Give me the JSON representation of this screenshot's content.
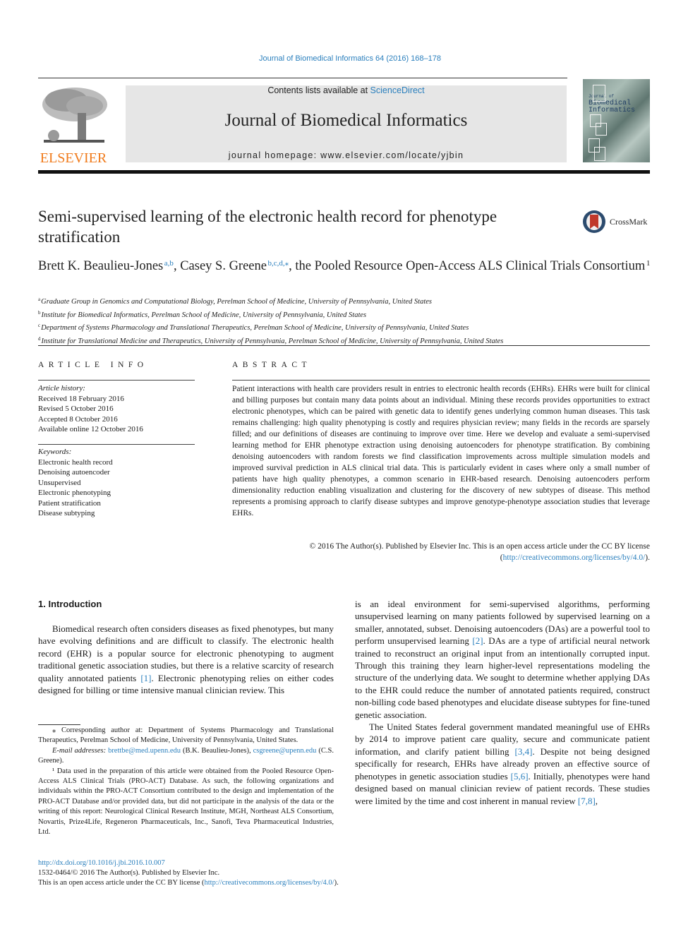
{
  "header": {
    "journal_ref": "Journal of Biomedical Informatics 64 (2016) 168–178",
    "contents_prefix": "Contents lists available at ",
    "contents_link": "ScienceDirect",
    "journal_title": "Journal of Biomedical Informatics",
    "homepage": "journal homepage: www.elsevier.com/locate/yjbin",
    "publisher_logo_text": "ELSEVIER",
    "cover_text": [
      "Journal of",
      "Biomedical",
      "Informatics"
    ],
    "crossmark_label": "CrossMark"
  },
  "colors": {
    "link": "#2a7fbd",
    "elsevier_orange": "#f07b1c",
    "banner_gray": "#e6e6e6"
  },
  "article": {
    "title": "Semi-supervised learning of the electronic health record for phenotype stratification",
    "authors": [
      {
        "name": "Brett K. Beaulieu-Jones",
        "sup": "a,b",
        "sep": ", "
      },
      {
        "name": "Casey S. Greene",
        "sup": "b,c,d,⁎",
        "sep": ", "
      },
      {
        "name": "the Pooled Resource Open-Access ALS Clinical Trials Consortium",
        "sup": "1",
        "sep": ""
      }
    ],
    "affiliations": [
      {
        "key": "a",
        "text": "Graduate Group in Genomics and Computational Biology, Perelman School of Medicine, University of Pennsylvania, United States"
      },
      {
        "key": "b",
        "text": "Institute for Biomedical Informatics, Perelman School of Medicine, University of Pennsylvania, United States"
      },
      {
        "key": "c",
        "text": "Department of Systems Pharmacology and Translational Therapeutics, Perelman School of Medicine, University of Pennsylvania, United States"
      },
      {
        "key": "d",
        "text": "Institute for Translational Medicine and Therapeutics, University of Pennsylvania, Perelman School of Medicine, University of Pennsylvania, United States"
      }
    ]
  },
  "article_info": {
    "heading": "ARTICLE INFO",
    "history_label": "Article history:",
    "history": [
      "Received 18 February 2016",
      "Revised 5 October 2016",
      "Accepted 8 October 2016",
      "Available online 12 October 2016"
    ],
    "keywords_label": "Keywords:",
    "keywords": [
      "Electronic health record",
      "Denoising autoencoder",
      "Unsupervised",
      "Electronic phenotyping",
      "Patient stratification",
      "Disease subtyping"
    ]
  },
  "abstract": {
    "heading": "ABSTRACT",
    "text": "Patient interactions with health care providers result in entries to electronic health records (EHRs). EHRs were built for clinical and billing purposes but contain many data points about an individual. Mining these records provides opportunities to extract electronic phenotypes, which can be paired with genetic data to identify genes underlying common human diseases. This task remains challenging: high quality phenotyping is costly and requires physician review; many fields in the records are sparsely filled; and our definitions of diseases are continuing to improve over time. Here we develop and evaluate a semi-supervised learning method for EHR phenotype extraction using denoising autoencoders for phenotype stratification. By combining denoising autoencoders with random forests we find classification improvements across multiple simulation models and improved survival prediction in ALS clinical trial data. This is particularly evident in cases where only a small number of patients have high quality phenotypes, a common scenario in EHR-based research. Denoising autoencoders perform dimensionality reduction enabling visualization and clustering for the discovery of new subtypes of disease. This method represents a promising approach to clarify disease subtypes and improve genotype-phenotype association studies that leverage EHRs.",
    "license_text": "© 2016 The Author(s). Published by Elsevier Inc. This is an open access article under the CC BY license",
    "license_link": "http://creativecommons.org/licenses/by/4.0/"
  },
  "intro": {
    "heading": "1. Introduction",
    "p1_a": "Biomedical research often considers diseases as fixed phenotypes, but many have evolving definitions and are difficult to classify. The electronic health record (EHR) is a popular source for electronic phenotyping to augment traditional genetic association studies, but there is a relative scarcity of research quality annotated patients ",
    "p1_ref": "[1]",
    "p1_b": ". Electronic phenotyping relies on either codes designed for billing or time intensive manual clinician review. This",
    "col2_p1_a": "is an ideal environment for semi-supervised algorithms, performing unsupervised learning on many patients followed by supervised learning on a smaller, annotated, subset. Denoising autoencoders (DAs) are a powerful tool to perform unsupervised learning ",
    "col2_p1_ref": "[2]",
    "col2_p1_b": ". DAs are a type of artificial neural network trained to reconstruct an original input from an intentionally corrupted input. Through this training they learn higher-level representations modeling the structure of the underlying data. We sought to determine whether applying DAs to the EHR could reduce the number of annotated patients required, construct non-billing code based phenotypes and elucidate disease subtypes for fine-tuned genetic association.",
    "col2_p2_a": "The United States federal government mandated meaningful use of EHRs by 2014 to improve patient care quality, secure and communicate patient information, and clarify patient billing ",
    "col2_p2_ref1": "[3,4]",
    "col2_p2_b": ". Despite not being designed specifically for research, EHRs have already proven an effective source of phenotypes in genetic association studies ",
    "col2_p2_ref2": "[5,6]",
    "col2_p2_c": ". Initially, phenotypes were hand designed based on manual clinician review of patient records. These studies were limited by the time and cost inherent in manual review ",
    "col2_p2_ref3": "[7,8]",
    "col2_p2_d": ","
  },
  "footnotes": {
    "corresponding": "⁎ Corresponding author at: Department of Systems Pharmacology and Translational Therapeutics, Perelman School of Medicine, University of Pennsylvania, United States.",
    "email_label": "E-mail addresses: ",
    "email1": "brettbe@med.upenn.edu",
    "email1_who": " (B.K. Beaulieu-Jones), ",
    "email2": "csgreene@upenn.edu",
    "email2_who": " (C.S. Greene).",
    "note1": "¹ Data used in the preparation of this article were obtained from the Pooled Resource Open-Access ALS Clinical Trials (PRO-ACT) Database. As such, the following organizations and individuals within the PRO-ACT Consortium contributed to the design and implementation of the PRO-ACT Database and/or provided data, but did not participate in the analysis of the data or the writing of this report: Neurological Clinical Research Institute, MGH, Northeast ALS Consortium, Novartis, Prize4Life, Regeneron Pharmaceuticals, Inc., Sanofi, Teva Pharmaceutical Industries, Ltd."
  },
  "bottom": {
    "doi": "http://dx.doi.org/10.1016/j.jbi.2016.10.007",
    "issn": "1532-0464/© 2016 The Author(s). Published by Elsevier Inc.",
    "oa_text": "This is an open access article under the CC BY license (",
    "oa_link": "http://creativecommons.org/licenses/by/4.0/",
    "oa_end": ")."
  }
}
